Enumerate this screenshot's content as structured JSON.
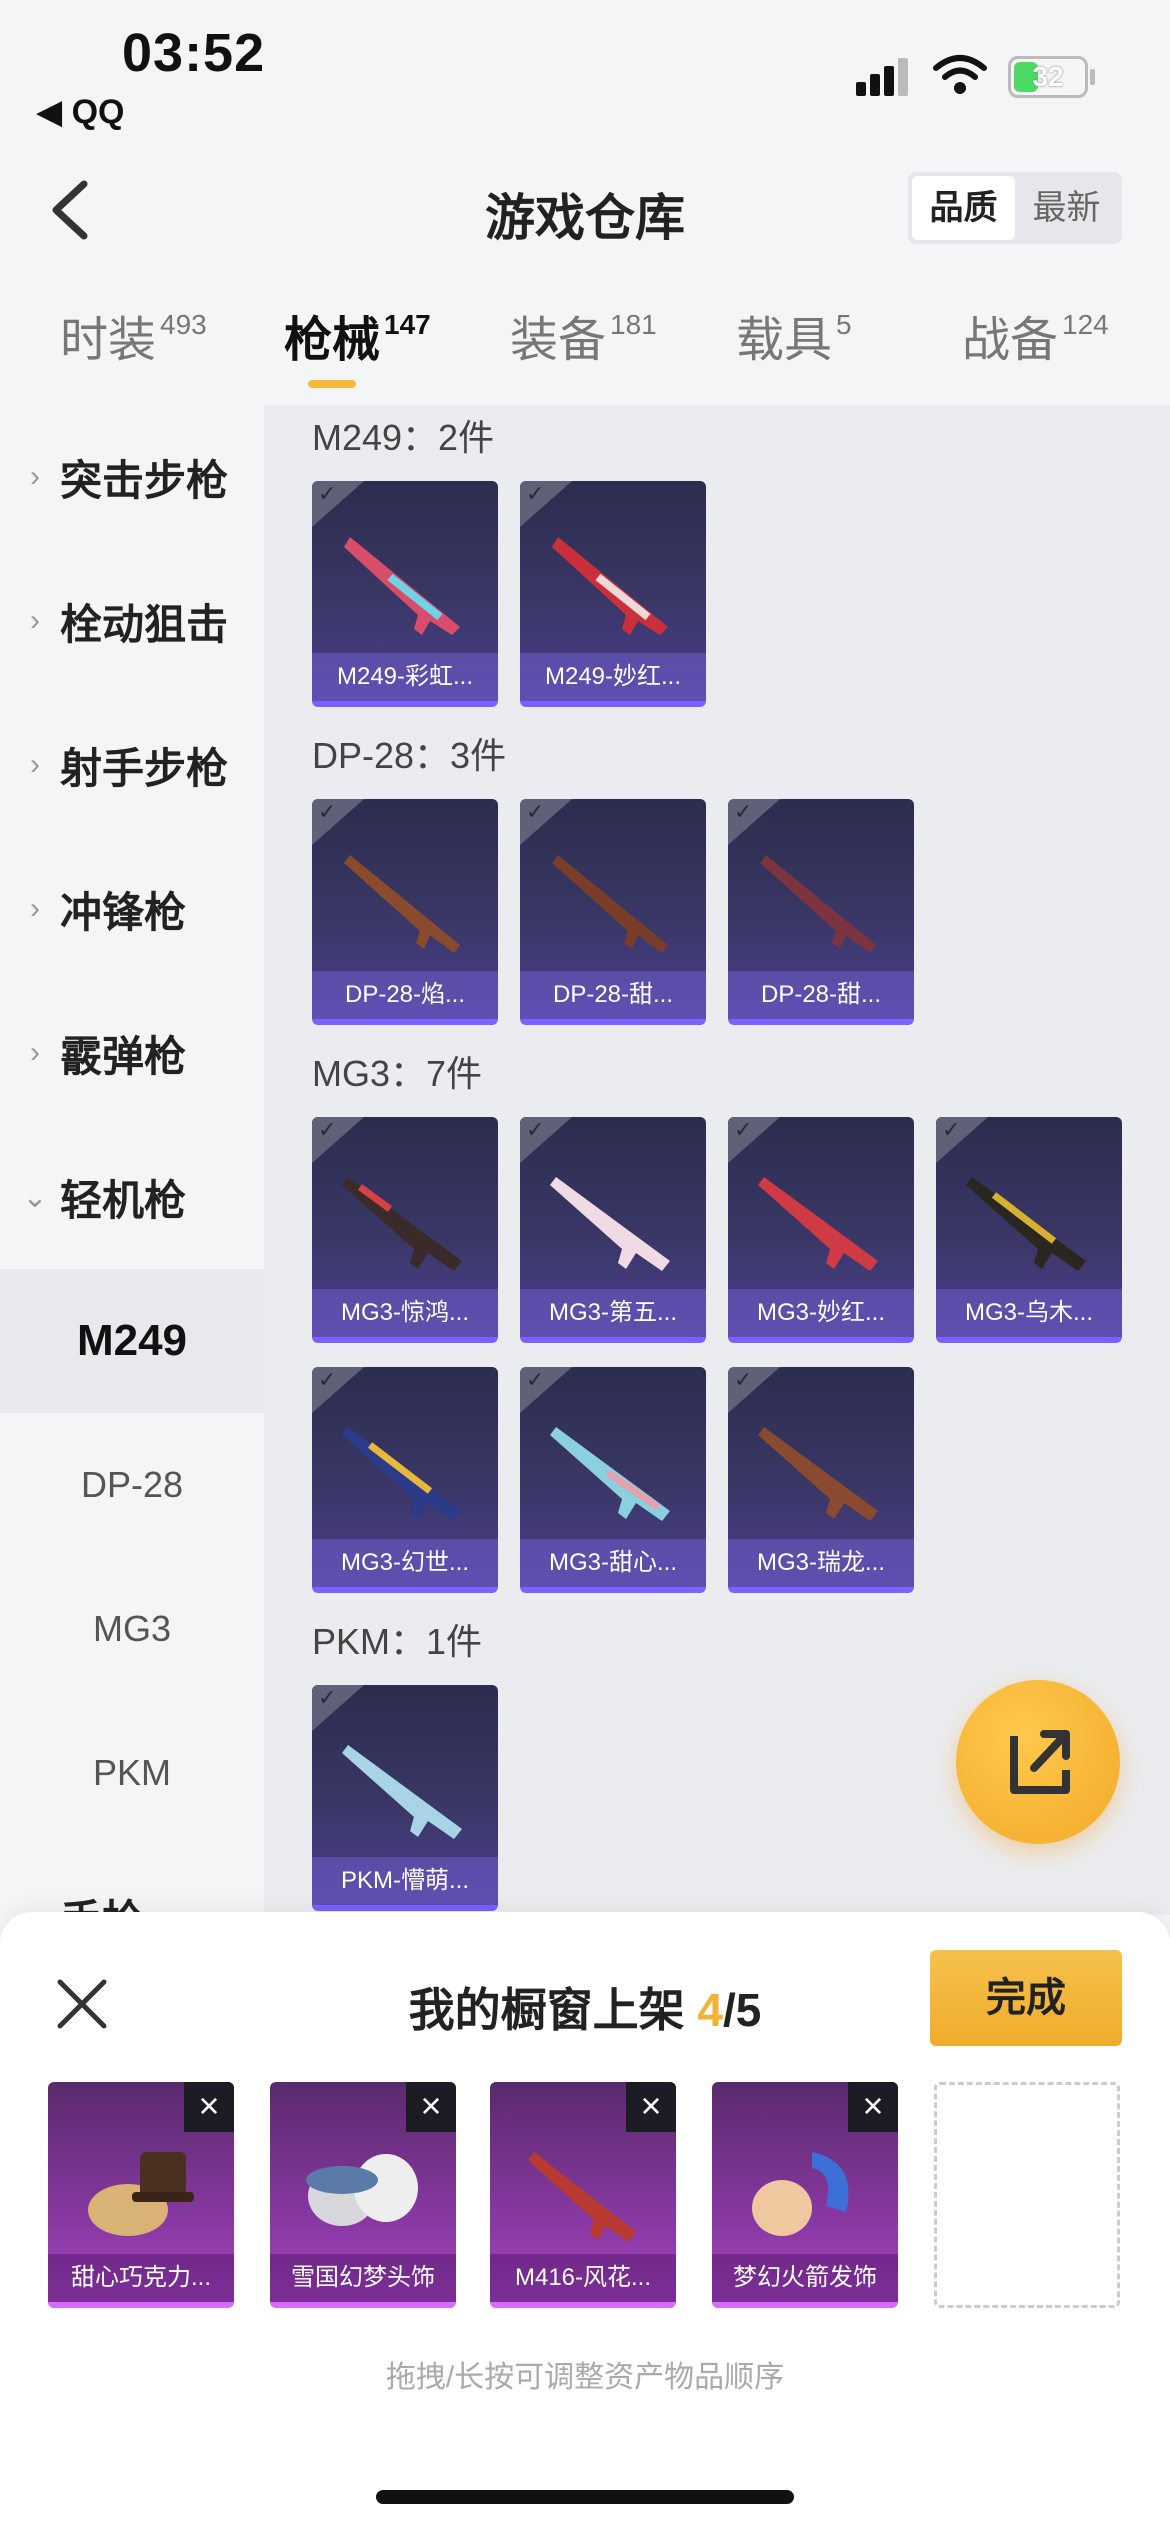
{
  "status_bar": {
    "time": "03:52",
    "back_app": "◀ QQ",
    "battery": "32"
  },
  "header": {
    "title": "游戏仓库",
    "sort_options": [
      "品质",
      "最新"
    ]
  },
  "tabs": [
    {
      "label": "时装",
      "count": "493"
    },
    {
      "label": "枪械",
      "count": "147"
    },
    {
      "label": "装备",
      "count": "181"
    },
    {
      "label": "载具",
      "count": "5"
    },
    {
      "label": "战备",
      "count": "124"
    }
  ],
  "sidebar": {
    "categories": [
      "突击步枪",
      "栓动狙击",
      "射手步枪",
      "冲锋枪",
      "霰弹枪",
      "轻机枪",
      "手枪"
    ],
    "sub_items": [
      "M249",
      "DP-28",
      "MG3",
      "PKM"
    ]
  },
  "groups": [
    {
      "title": "M249：2件",
      "items": [
        "M249-彩虹...",
        "M249-妙红..."
      ]
    },
    {
      "title": "DP-28：3件",
      "items": [
        "DP-28-焰...",
        "DP-28-甜...",
        "DP-28-甜..."
      ]
    },
    {
      "title": "MG3：7件",
      "items": [
        "MG3-惊鸿...",
        "MG3-第五...",
        "MG3-妙红...",
        "MG3-乌木...",
        "MG3-幻世...",
        "MG3-甜心...",
        "MG3-瑞龙..."
      ]
    },
    {
      "title": "PKM：1件",
      "items": [
        "PKM-懵萌..."
      ]
    }
  ],
  "sheet": {
    "title": "我的橱窗上架",
    "count_current": "4",
    "count_total": "/5",
    "done_label": "完成",
    "items": [
      "甜心巧克力...",
      "雪国幻梦头饰",
      "M416-风花...",
      "梦幻火箭发饰"
    ],
    "hint": "拖拽/长按可调整资产物品顺序"
  },
  "colors": {
    "accent": "#f2b233",
    "card_gun": "#3a3766",
    "card_shelf": "#8d3aa8"
  }
}
